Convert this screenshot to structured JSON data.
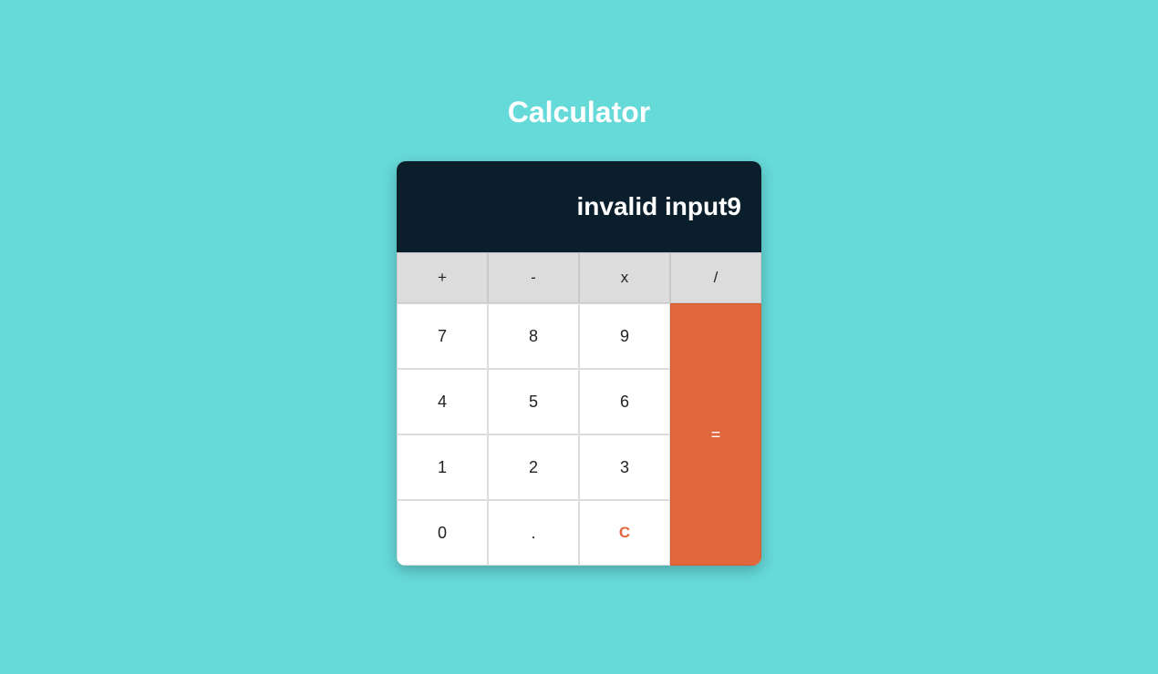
{
  "title": "Calculator",
  "display_value": "invalid input9",
  "operators": {
    "add": "+",
    "subtract": "-",
    "multiply": "x",
    "divide": "/"
  },
  "digits": {
    "d7": "7",
    "d8": "8",
    "d9": "9",
    "d4": "4",
    "d5": "5",
    "d6": "6",
    "d1": "1",
    "d2": "2",
    "d3": "3",
    "d0": "0",
    "decimal": "."
  },
  "clear_label": "C",
  "equals_label": "="
}
